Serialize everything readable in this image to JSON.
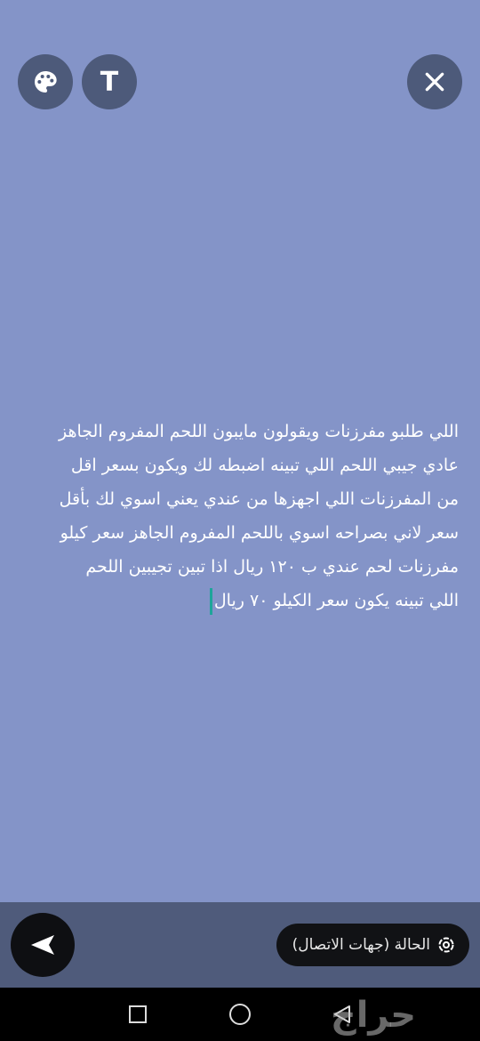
{
  "toolbar": {
    "palette_icon": "palette-icon",
    "text_label": "T",
    "close_icon": "close-icon"
  },
  "status": {
    "text": "اللي طلبو مفرزنات ويقولون مايبون اللحم المفروم الجاهز\nعادي جيبي اللحم اللي تبينه  اضبطه لك ويكون بسعر اقل\nمن المفرزنات اللي اجهزها من عندي  يعني اسوي لك بأقل\nسعر لاني بصراحه اسوي باللحم المفروم الجاهز سعر كيلو\nمفرزنات لحم  عندي ب ١٢٠ ريال اذا  تبين تجيبين اللحم\nاللي تبينه  يكون سعر الكيلو ٧٠ ريال"
  },
  "footer": {
    "audience_label": "الحالة (جهات الاتصال)",
    "send_icon": "send-icon"
  },
  "navbar": {
    "recents_icon": "square-icon",
    "home_icon": "circle-icon",
    "back_icon": "back-triangle-icon"
  },
  "watermark": {
    "text": "حراج"
  },
  "colors": {
    "background": "#8494c8",
    "button": "#4d5a7a",
    "caret": "#1ea59a"
  }
}
